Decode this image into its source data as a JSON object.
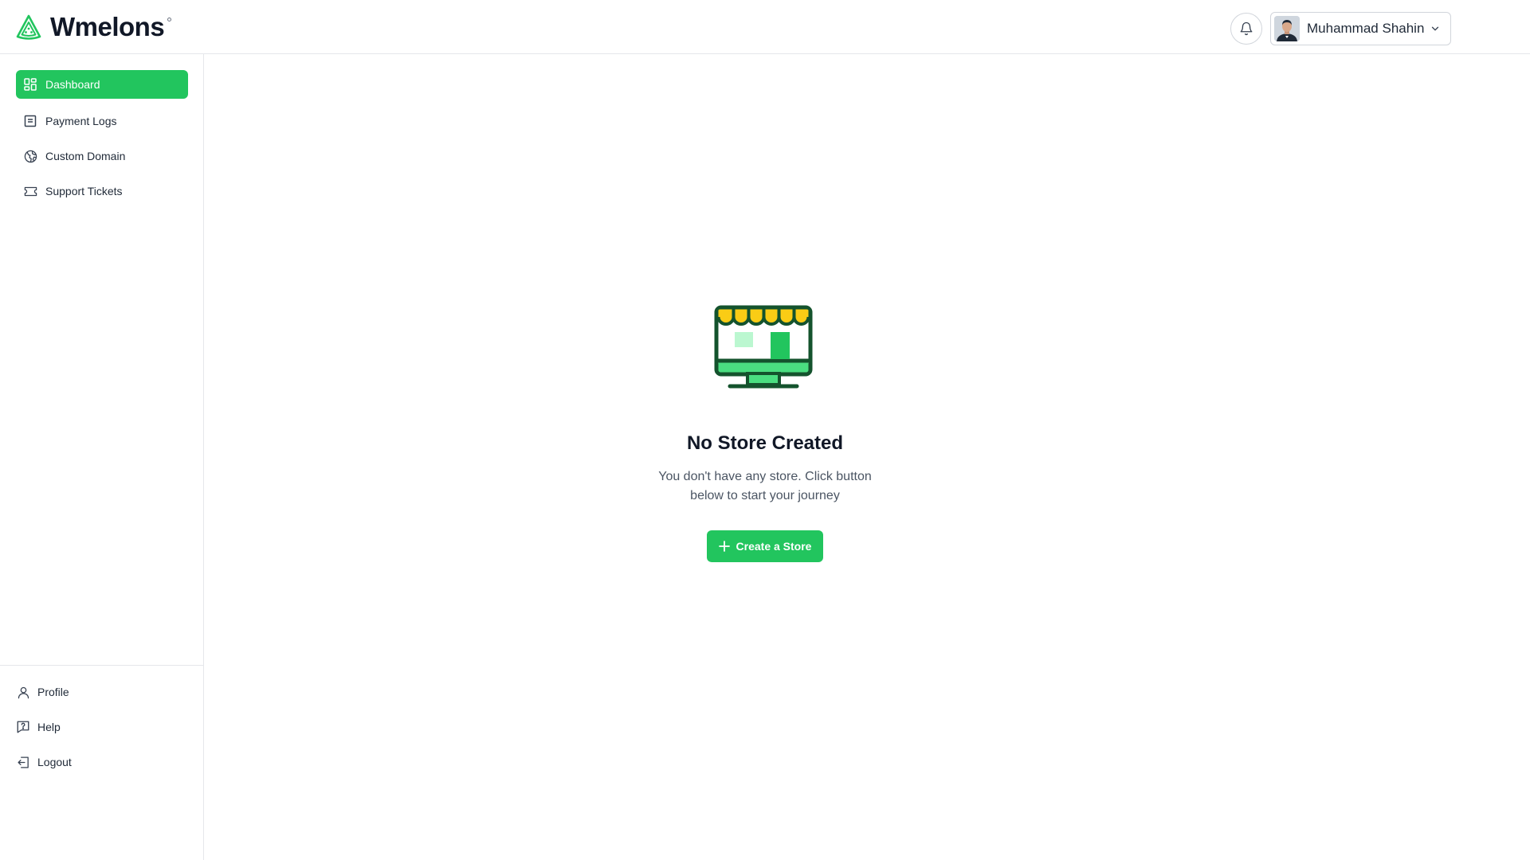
{
  "app": {
    "logo_text": "Wmelons",
    "logo_icon": "watermelon-slice-icon"
  },
  "header": {
    "notification_icon": "bell-icon",
    "user": {
      "name": "Muhammad Shahin",
      "dropdown_icon": "chevron-down-icon"
    }
  },
  "sidebar": {
    "items": [
      {
        "label": "Dashboard",
        "icon": "dashboard-grid-icon",
        "active": true
      },
      {
        "label": "Payment Logs",
        "icon": "document-list-icon",
        "active": false
      },
      {
        "label": "Custom Domain",
        "icon": "globe-icon",
        "active": false
      },
      {
        "label": "Support Tickets",
        "icon": "ticket-icon",
        "active": false
      }
    ],
    "bottom_items": [
      {
        "label": "Profile",
        "icon": "user-icon"
      },
      {
        "label": "Help",
        "icon": "help-message-icon"
      },
      {
        "label": "Logout",
        "icon": "logout-icon"
      }
    ]
  },
  "main": {
    "empty_state": {
      "illustration": "storefront-monitor-icon",
      "title": "No Store Created",
      "description": "You don't have any store. Click button below to start your journey",
      "button_label": "Create a Store",
      "button_icon": "plus-icon"
    }
  },
  "colors": {
    "accent": "#22c55e",
    "awning": "#facc15",
    "dark_green": "#14532d",
    "light_green": "#bbf7d0"
  }
}
